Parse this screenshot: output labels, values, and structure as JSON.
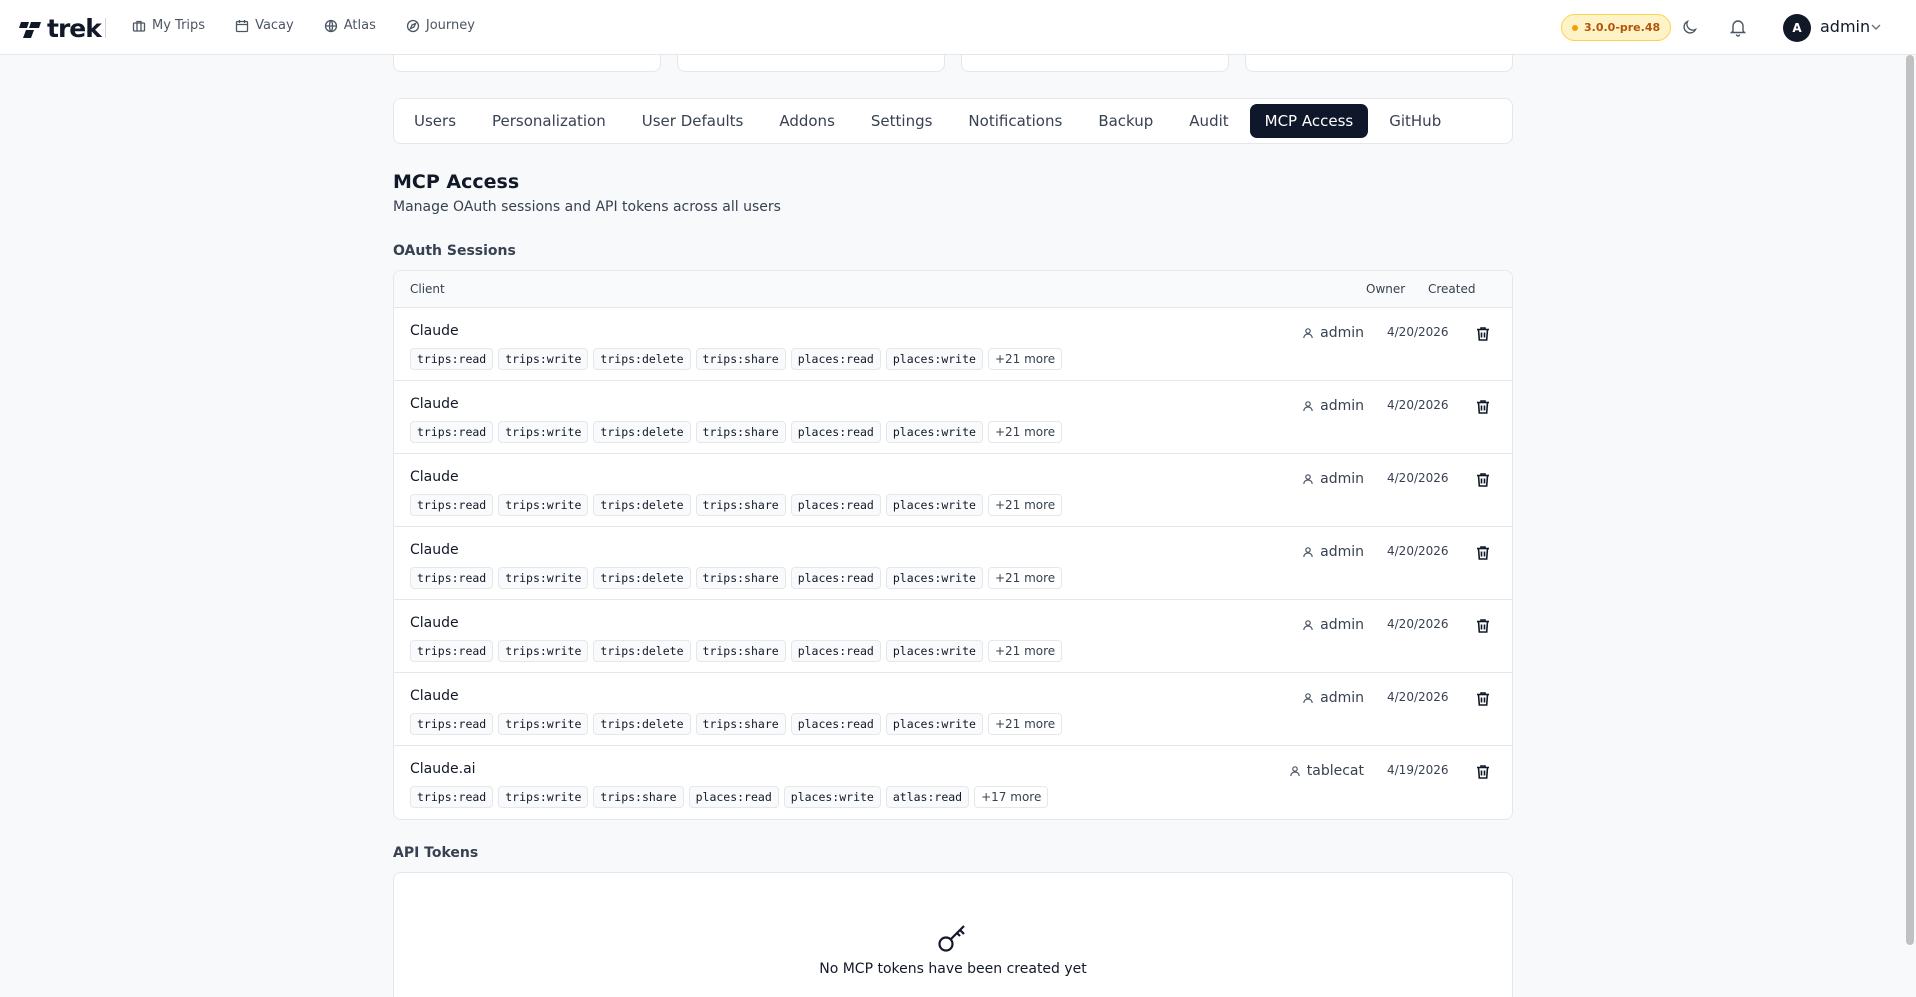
{
  "brand": {
    "name": "trek"
  },
  "nav": [
    {
      "label": "My Trips",
      "icon": "briefcase-icon"
    },
    {
      "label": "Vacay",
      "icon": "calendar-icon"
    },
    {
      "label": "Atlas",
      "icon": "globe-icon"
    },
    {
      "label": "Journey",
      "icon": "compass-icon"
    }
  ],
  "header": {
    "version": "3.0.0-pre.48",
    "avatar_initial": "A",
    "user": "admin"
  },
  "tabs": [
    {
      "label": "Users"
    },
    {
      "label": "Personalization"
    },
    {
      "label": "User Defaults"
    },
    {
      "label": "Addons"
    },
    {
      "label": "Settings"
    },
    {
      "label": "Notifications"
    },
    {
      "label": "Backup"
    },
    {
      "label": "Audit"
    },
    {
      "label": "MCP Access",
      "active": true
    },
    {
      "label": "GitHub"
    }
  ],
  "page": {
    "title": "MCP Access",
    "subtitle": "Manage OAuth sessions and API tokens across all users"
  },
  "sessions": {
    "heading": "OAuth Sessions",
    "columns": {
      "client": "Client",
      "owner": "Owner",
      "created": "Created"
    },
    "rows": [
      {
        "client": "Claude",
        "scopes": [
          "trips:read",
          "trips:write",
          "trips:delete",
          "trips:share",
          "places:read",
          "places:write"
        ],
        "more": "+21 more",
        "owner": "admin",
        "created": "4/20/2026"
      },
      {
        "client": "Claude",
        "scopes": [
          "trips:read",
          "trips:write",
          "trips:delete",
          "trips:share",
          "places:read",
          "places:write"
        ],
        "more": "+21 more",
        "owner": "admin",
        "created": "4/20/2026"
      },
      {
        "client": "Claude",
        "scopes": [
          "trips:read",
          "trips:write",
          "trips:delete",
          "trips:share",
          "places:read",
          "places:write"
        ],
        "more": "+21 more",
        "owner": "admin",
        "created": "4/20/2026"
      },
      {
        "client": "Claude",
        "scopes": [
          "trips:read",
          "trips:write",
          "trips:delete",
          "trips:share",
          "places:read",
          "places:write"
        ],
        "more": "+21 more",
        "owner": "admin",
        "created": "4/20/2026"
      },
      {
        "client": "Claude",
        "scopes": [
          "trips:read",
          "trips:write",
          "trips:delete",
          "trips:share",
          "places:read",
          "places:write"
        ],
        "more": "+21 more",
        "owner": "admin",
        "created": "4/20/2026"
      },
      {
        "client": "Claude",
        "scopes": [
          "trips:read",
          "trips:write",
          "trips:delete",
          "trips:share",
          "places:read",
          "places:write"
        ],
        "more": "+21 more",
        "owner": "admin",
        "created": "4/20/2026"
      },
      {
        "client": "Claude.ai",
        "scopes": [
          "trips:read",
          "trips:write",
          "trips:share",
          "places:read",
          "places:write",
          "atlas:read"
        ],
        "more": "+17 more",
        "owner": "tablecat",
        "created": "4/19/2026"
      }
    ]
  },
  "tokens": {
    "heading": "API Tokens",
    "empty": "No MCP tokens have been created yet"
  },
  "colors": {
    "accent": "#0f172a",
    "version_bg": "#fef3c7",
    "version_text": "#b45309"
  }
}
